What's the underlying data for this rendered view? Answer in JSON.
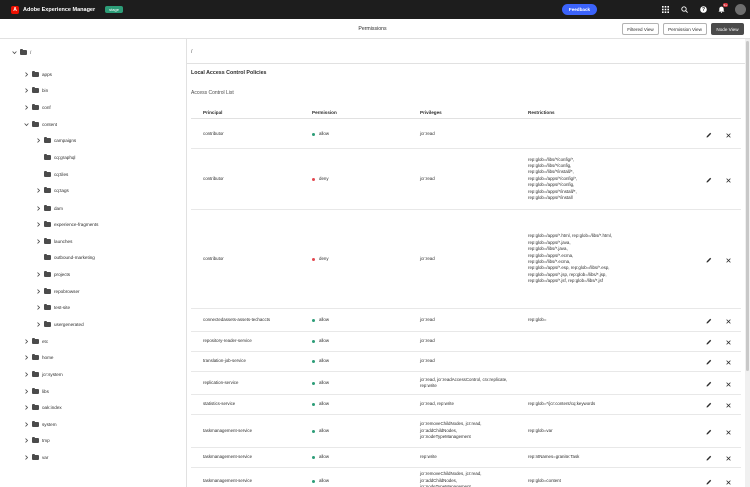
{
  "topbar": {
    "logo_letter": "A",
    "title": "Adobe Experience Manager",
    "env_badge": "stage",
    "feedback_label": "Feedback",
    "notification_count": "9+",
    "icons": [
      "apps-grid-icon",
      "search-icon",
      "help-icon",
      "bell-icon",
      "avatar"
    ]
  },
  "header": {
    "title": "Permissions",
    "views": [
      "Filtered View",
      "Permission View",
      "Node View"
    ],
    "active_view": "Node View"
  },
  "tree": {
    "root": "/",
    "items": [
      {
        "label": "apps",
        "level": 1,
        "expanded": false
      },
      {
        "label": "bin",
        "level": 1,
        "expanded": false
      },
      {
        "label": "conf",
        "level": 1,
        "expanded": false
      },
      {
        "label": "content",
        "level": 1,
        "expanded": true
      },
      {
        "label": "campaigns",
        "level": 2,
        "expanded": false
      },
      {
        "label": "cq:graphql",
        "level": 2,
        "leaf": true
      },
      {
        "label": "cq:tiles",
        "level": 2,
        "leaf": true
      },
      {
        "label": "cq:tags",
        "level": 2,
        "expanded": false
      },
      {
        "label": "dam",
        "level": 2,
        "expanded": false
      },
      {
        "label": "experience-fragments",
        "level": 2,
        "expanded": false
      },
      {
        "label": "launches",
        "level": 2,
        "expanded": false
      },
      {
        "label": "outbound-marketing",
        "level": 2,
        "leaf": true
      },
      {
        "label": "projects",
        "level": 2,
        "expanded": false
      },
      {
        "label": "repobrowser",
        "level": 2,
        "expanded": false
      },
      {
        "label": "test-site",
        "level": 2,
        "expanded": false
      },
      {
        "label": "usergenerated",
        "level": 2,
        "expanded": false
      },
      {
        "label": "etc",
        "level": 1,
        "expanded": false
      },
      {
        "label": "home",
        "level": 1,
        "expanded": false
      },
      {
        "label": "jcr:system",
        "level": 1,
        "expanded": false
      },
      {
        "label": "libs",
        "level": 1,
        "expanded": false
      },
      {
        "label": "oak:index",
        "level": 1,
        "expanded": false
      },
      {
        "label": "system",
        "level": 1,
        "expanded": false
      },
      {
        "label": "tmp",
        "level": 1,
        "expanded": false
      },
      {
        "label": "var",
        "level": 1,
        "expanded": false
      }
    ]
  },
  "main": {
    "path": "/",
    "section_title": "Local Access Control Policies",
    "section_sub": "Access Control List",
    "columns": [
      "Principal",
      "Permission",
      "Privileges",
      "Restrictions"
    ],
    "rows": [
      {
        "principal": "contributor",
        "permission": "allow",
        "privileges": "jcr:read",
        "restrictions": ""
      },
      {
        "principal": "contributor",
        "permission": "deny",
        "privileges": "jcr:read",
        "restrictions": "rep:glob=/libs/*/config/*,\nrep:glob=/libs/*/config,\nrep:glob=/libs/*/install/*,\nrep:glob=/apps/*/config/*,\nrep:glob=/apps/*/config,\nrep:glob=/apps/*/install/*,\nrep:glob=/apps/*/install"
      },
      {
        "principal": "contributor",
        "permission": "deny",
        "privileges": "jcr:read",
        "restrictions": "rep:glob=/apps/*.html, rep:glob=/libs/*.html,\nrep:glob=/apps/*.java,\nrep:glob=/libs/*.java,\nrep:glob=/apps/*.ecma,\nrep:glob=/libs/*.ecma,\nrep:glob=/apps/*.esp, rep:glob=/libs/*.esp,\nrep:glob=/apps/*.jsp, rep:glob=/libs/*.jsp,\nrep:glob=/apps/*.jsf, rep:glob=/libs/*.jsf"
      },
      {
        "principal": "connectedassets-assets-techaccts",
        "permission": "allow",
        "privileges": "jcr:read",
        "restrictions": "rep:glob="
      },
      {
        "principal": "repository-reader-service",
        "permission": "allow",
        "privileges": "jcr:read",
        "restrictions": ""
      },
      {
        "principal": "translation-job-service",
        "permission": "allow",
        "privileges": "jcr:read",
        "restrictions": ""
      },
      {
        "principal": "replication-service",
        "permission": "allow",
        "privileges": "jcr:read, jcr:readAccessControl, crx:replicate,\nrep:write",
        "restrictions": ""
      },
      {
        "principal": "statistics-service",
        "permission": "allow",
        "privileges": "jcr:read, rep:write",
        "restrictions": "rep:glob=*/jcr:content/cq:keywords"
      },
      {
        "principal": "taskmanagement-service",
        "permission": "allow",
        "privileges": "jcr:removeChildNodes, jcr:read,\njcr:addChildNodes,\njcr:nodeTypeManagement",
        "restrictions": "rep:glob=var"
      },
      {
        "principal": "taskmanagement-service",
        "permission": "allow",
        "privileges": "rep:write",
        "restrictions": "rep:ntNames=granite:Task"
      },
      {
        "principal": "taskmanagement-service",
        "permission": "allow",
        "privileges": "jcr:removeChildNodes, jcr:read,\njcr:addChildNodes,\njcr:nodeTypeManagement",
        "restrictions": "rep:glob=content"
      }
    ]
  },
  "colors": {
    "allow": "#2d9d78",
    "deny": "#e34850",
    "accent": "#3b63fb"
  }
}
